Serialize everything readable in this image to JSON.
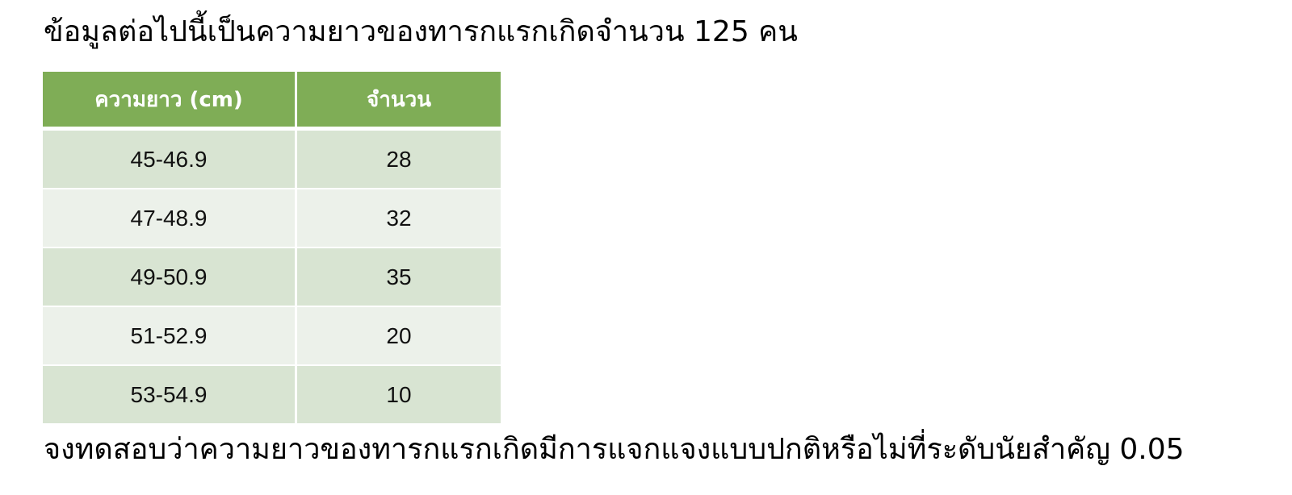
{
  "intro_text": "ข้อมูลต่อไปนี้เป็นความยาวของทารกแรกเกิดจำนวน 125 คน",
  "table": {
    "headers": [
      "ความยาว (cm)",
      "จำนวน"
    ],
    "rows": [
      [
        "45-46.9",
        "28"
      ],
      [
        "47-48.9",
        "32"
      ],
      [
        "49-50.9",
        "35"
      ],
      [
        "51-52.9",
        "20"
      ],
      [
        "53-54.9",
        "10"
      ]
    ]
  },
  "question_text": "จงทดสอบว่าความยาวของทารกแรกเกิดมีการแจกแจงแบบปกติหรือไม่ที่ระดับนัยสำคัญ 0.05",
  "colors": {
    "header_bg": "#7fad56",
    "row_dark": "#d8e4d2",
    "row_light": "#ecf1ea"
  }
}
